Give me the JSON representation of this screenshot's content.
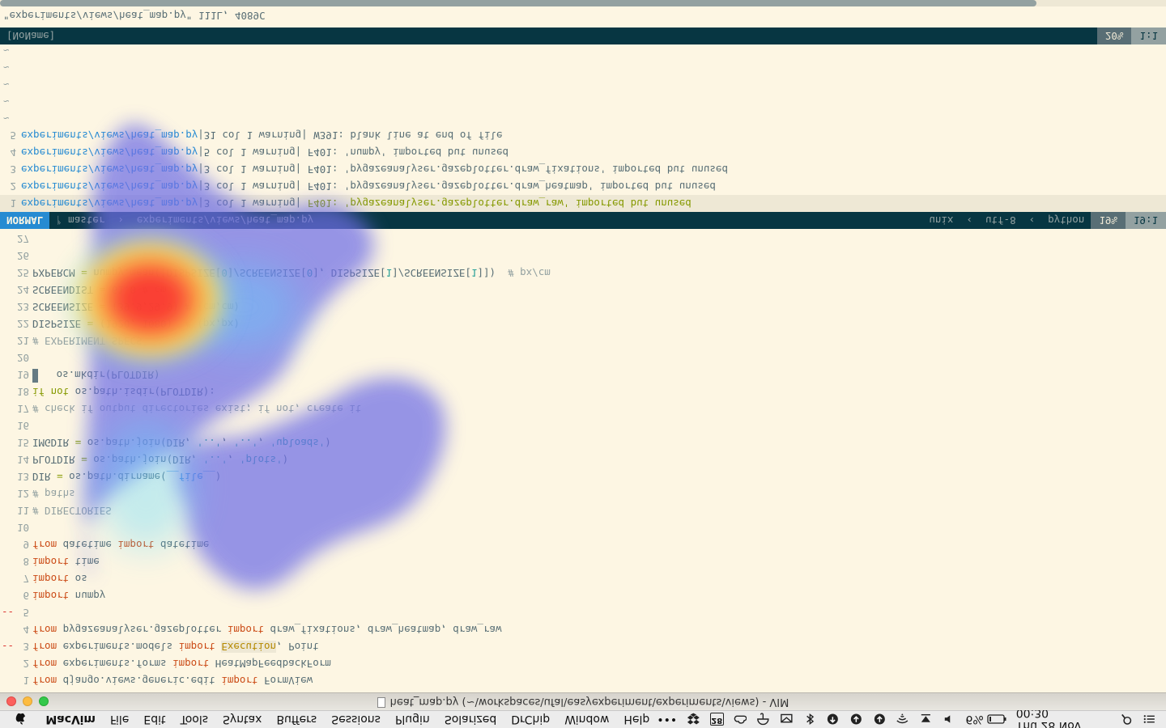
{
  "menubar": {
    "app": "MacVim",
    "items": [
      "File",
      "Edit",
      "Tools",
      "Syntax",
      "Buffers",
      "Sessions",
      "Plugin",
      "Solarized",
      "DrChip",
      "Window",
      "Help"
    ],
    "status": {
      "dots": "•••",
      "calendar_day": "28",
      "battery_pct": "6%",
      "clock": "Thu 28 Nov  00:30"
    }
  },
  "window": {
    "title": "heat_map.py (~\\workspaces\\ufal\\easyexperiment\\experiments\\views) - VIM"
  },
  "editor": {
    "lines": [
      {
        "n": "1",
        "sign": "",
        "tokens": [
          [
            "kw",
            "from"
          ],
          [
            "code",
            " django.views.generic.edit "
          ],
          [
            "kw",
            "import"
          ],
          [
            "code",
            " FormView"
          ]
        ]
      },
      {
        "n": "2",
        "sign": "",
        "tokens": [
          [
            "kw",
            "from"
          ],
          [
            "code",
            " experiments.forms "
          ],
          [
            "kw",
            "import"
          ],
          [
            "code",
            " HeatMapFeedbackForm"
          ]
        ]
      },
      {
        "n": "3",
        "sign": "--",
        "tokens": [
          [
            "kw",
            "from"
          ],
          [
            "code",
            " experiments.models "
          ],
          [
            "kw",
            "import"
          ],
          [
            "code",
            " "
          ],
          [
            "hl-err",
            "Execution"
          ],
          [
            "code",
            ", Point"
          ]
        ]
      },
      {
        "n": "4",
        "sign": "",
        "tokens": [
          [
            "kw",
            "from"
          ],
          [
            "code",
            " pygazeanalyser.gazeplotter "
          ],
          [
            "kw",
            "import"
          ],
          [
            "code",
            " draw_fixations, draw_heatmap, draw_raw"
          ]
        ]
      },
      {
        "n": "5",
        "sign": "--",
        "tokens": []
      },
      {
        "n": "6",
        "sign": "",
        "tokens": [
          [
            "kw",
            "import"
          ],
          [
            "code",
            " numpy"
          ]
        ]
      },
      {
        "n": "7",
        "sign": "",
        "tokens": [
          [
            "kw",
            "import"
          ],
          [
            "code",
            " os"
          ]
        ]
      },
      {
        "n": "8",
        "sign": "",
        "tokens": [
          [
            "kw",
            "import"
          ],
          [
            "code",
            " time"
          ]
        ]
      },
      {
        "n": "9",
        "sign": "",
        "tokens": [
          [
            "kw",
            "from"
          ],
          [
            "code",
            " datetime "
          ],
          [
            "kw",
            "import"
          ],
          [
            "code",
            " datetime"
          ]
        ]
      },
      {
        "n": "10",
        "sign": "",
        "tokens": []
      },
      {
        "n": "11",
        "sign": "",
        "tokens": [
          [
            "cmt",
            "# DIRECTORIES"
          ]
        ]
      },
      {
        "n": "12",
        "sign": "",
        "tokens": [
          [
            "cmt",
            "# paths"
          ]
        ]
      },
      {
        "n": "13",
        "sign": "",
        "tokens": [
          [
            "code",
            "DIR "
          ],
          [
            "kw2",
            "="
          ],
          [
            "code",
            " os.path.dirname("
          ],
          [
            "const",
            "__file__"
          ],
          [
            "code",
            ")"
          ]
        ]
      },
      {
        "n": "14",
        "sign": "",
        "tokens": [
          [
            "code",
            "PLOTDIR "
          ],
          [
            "kw2",
            "="
          ],
          [
            "code",
            " os.path.join(DIR, "
          ],
          [
            "str",
            "'..'"
          ],
          [
            "code",
            ", "
          ],
          [
            "str",
            "'plots'"
          ],
          [
            "code",
            ")"
          ]
        ]
      },
      {
        "n": "15",
        "sign": "",
        "tokens": [
          [
            "code",
            "IMGDIR "
          ],
          [
            "kw2",
            "="
          ],
          [
            "code",
            " os.path.join(DIR, "
          ],
          [
            "str",
            "'..'"
          ],
          [
            "code",
            ", "
          ],
          [
            "str",
            "'..'"
          ],
          [
            "code",
            ", "
          ],
          [
            "str",
            "'uploads'"
          ],
          [
            "code",
            ")"
          ]
        ]
      },
      {
        "n": "16",
        "sign": "",
        "tokens": []
      },
      {
        "n": "17",
        "sign": "",
        "tokens": [
          [
            "cmt",
            "# check if output directories exist; if not, create it"
          ]
        ]
      },
      {
        "n": "18",
        "sign": "",
        "tokens": [
          [
            "kw2",
            "if not"
          ],
          [
            "code",
            " os.path.isdir(PLOTDIR):"
          ]
        ]
      },
      {
        "n": "19",
        "sign": "",
        "tokens": [
          [
            "cursor",
            ""
          ],
          [
            "code",
            "   os.mkdir(PLOTDIR)"
          ]
        ]
      },
      {
        "n": "20",
        "sign": "",
        "tokens": []
      },
      {
        "n": "21",
        "sign": "",
        "tokens": [
          [
            "cmt",
            "# EXPERIMENT SPECS"
          ]
        ]
      },
      {
        "n": "22",
        "sign": "",
        "tokens": [
          [
            "code",
            "DISPSIZE "
          ],
          [
            "kw2",
            "="
          ],
          [
            "code",
            " ("
          ],
          [
            "num",
            "1920"
          ],
          [
            "code",
            ", "
          ],
          [
            "num",
            "1080"
          ],
          [
            "code",
            ")  "
          ],
          [
            "cmt",
            "# (px,px)"
          ]
        ]
      },
      {
        "n": "23",
        "sign": "",
        "tokens": [
          [
            "code",
            "SCREENSIZE "
          ],
          [
            "kw2",
            "="
          ],
          [
            "code",
            " ("
          ],
          [
            "num",
            "39.9"
          ],
          [
            "code",
            ","
          ],
          [
            "num",
            "29.9"
          ],
          [
            "code",
            ") "
          ],
          [
            "cmt",
            "# (cm,cm)"
          ]
        ]
      },
      {
        "n": "24",
        "sign": "",
        "tokens": [
          [
            "code",
            "SCREENDIST "
          ],
          [
            "kw2",
            "="
          ],
          [
            "code",
            " "
          ],
          [
            "num",
            "61.0"
          ],
          [
            "code",
            " "
          ],
          [
            "cmt",
            "# cm"
          ]
        ]
      },
      {
        "n": "25",
        "sign": "",
        "tokens": [
          [
            "code",
            "PXPERCM "
          ],
          [
            "kw2",
            "="
          ],
          [
            "code",
            " numpy.mean([DISPSIZE["
          ],
          [
            "num",
            "0"
          ],
          [
            "code",
            "]/SCREENSIZE["
          ],
          [
            "num",
            "0"
          ],
          [
            "code",
            "], DISPSIZE["
          ],
          [
            "num",
            "1"
          ],
          [
            "code",
            "]/SCREENSIZE["
          ],
          [
            "num",
            "1"
          ],
          [
            "code",
            "]])  "
          ],
          [
            "cmt",
            "# px/cm"
          ]
        ]
      },
      {
        "n": "26",
        "sign": "",
        "tokens": []
      },
      {
        "n": "27",
        "sign": "",
        "tokens": []
      }
    ],
    "statusline": {
      "mode": "NORMAL",
      "branch": "ᚠ master",
      "file": "experiments/views/heat_map.py",
      "fileformat": "unix",
      "encoding": "utf-8",
      "filetype": "python",
      "percent": "19%",
      "position": "19:1"
    },
    "quickfix": [
      {
        "n": "1",
        "file": "experiments/views/heat_map.py",
        "loc": "|3 col 1 warning|",
        "msg": " F401: 'pygazeanalyser.gazeplotter.draw_raw' imported but unused",
        "current": true
      },
      {
        "n": "2",
        "file": "experiments/views/heat_map.py",
        "loc": "|3 col 1 warning|",
        "msg": " F401: 'pygazeanalyser.gazeplotter.draw_heatmap' imported but unused",
        "current": false
      },
      {
        "n": "3",
        "file": "experiments/views/heat_map.py",
        "loc": "|3 col 1 warning|",
        "msg": " F401: 'pygazeanalyser.gazeplotter.draw_fixations' imported but unused",
        "current": false
      },
      {
        "n": "4",
        "file": "experiments/views/heat_map.py",
        "loc": "|5 col 1 warning|",
        "msg": " F401: 'numpy' imported but unused",
        "current": false
      },
      {
        "n": "5",
        "file": "experiments/views/heat_map.py",
        "loc": "|31 col 1 warning|",
        "msg": " W391: blank line at end of file",
        "current": false
      }
    ],
    "quickfix_status": {
      "name": "[NoName]",
      "percent": "20%",
      "position": "1:1"
    },
    "tildes": [
      "~",
      "~",
      "~",
      "~",
      "~"
    ],
    "cmdline": "\"experiments/views/heat_map.py\" 111L, 4089C"
  },
  "heatmap": {
    "colors": {
      "low": "#6e6ee6",
      "mid": "#5ad7ff",
      "warm": "#ffe14a",
      "hot": "#ff3b2a"
    }
  }
}
